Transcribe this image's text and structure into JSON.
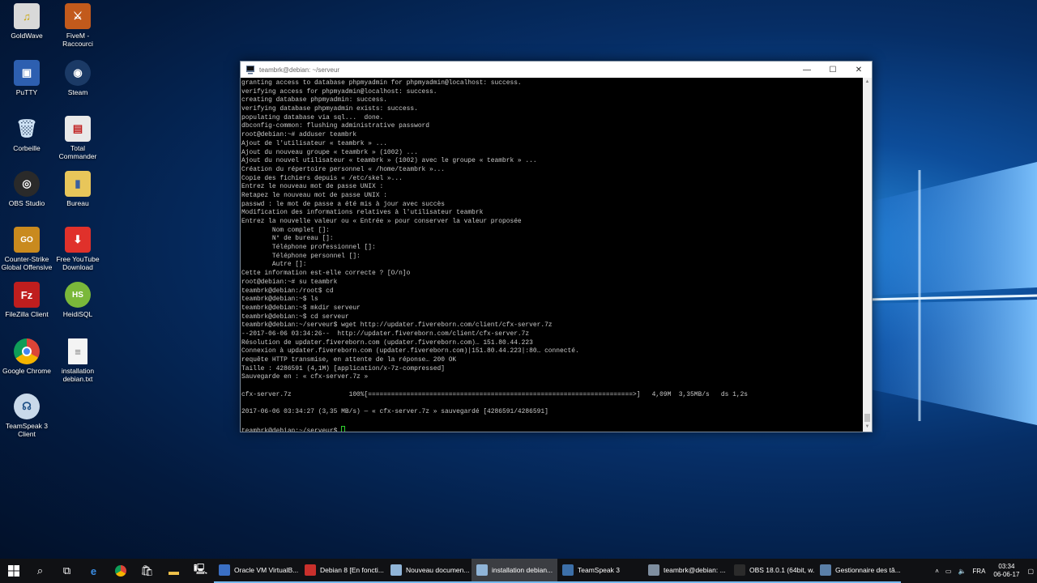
{
  "desktop_icons": [
    {
      "label": "GoldWave"
    },
    {
      "label": "FiveM - Raccourci"
    },
    {
      "label": "PuTTY"
    },
    {
      "label": "Steam"
    },
    {
      "label": "Corbeille"
    },
    {
      "label": "Total Commander"
    },
    {
      "label": "OBS Studio"
    },
    {
      "label": "Bureau"
    },
    {
      "label": "Counter-Strike Global Offensive"
    },
    {
      "label": "Free YouTube Download"
    },
    {
      "label": "FileZilla Client"
    },
    {
      "label": "HeidiSQL"
    },
    {
      "label": "Google Chrome"
    },
    {
      "label": "installation debian.txt"
    },
    {
      "label": "TeamSpeak 3 Client"
    }
  ],
  "window": {
    "title": "teambrk@debian: ~/serveur",
    "minimize": "—",
    "maximize": "☐",
    "close": "✕"
  },
  "terminal": {
    "lines": [
      "granting access to database phpmyadmin for phpmyadmin@localhost: success.",
      "verifying access for phpmyadmin@localhost: success.",
      "creating database phpmyadmin: success.",
      "verifying database phpmyadmin exists: success.",
      "populating database via sql...  done.",
      "dbconfig-common: flushing administrative password",
      "root@debian:~# adduser teambrk",
      "Ajout de l'utilisateur « teambrk » ...",
      "Ajout du nouveau groupe « teambrk » (1002) ...",
      "Ajout du nouvel utilisateur « teambrk » (1002) avec le groupe « teambrk » ...",
      "Création du répertoire personnel « /home/teambrk »...",
      "Copie des fichiers depuis « /etc/skel »...",
      "Entrez le nouveau mot de passe UNIX :",
      "Retapez le nouveau mot de passe UNIX :",
      "passwd : le mot de passe a été mis à jour avec succès",
      "Modification des informations relatives à l'utilisateur teambrk",
      "Entrez la nouvelle valeur ou « Entrée » pour conserver la valeur proposée",
      "        Nom complet []:",
      "        N° de bureau []:",
      "        Téléphone professionnel []:",
      "        Téléphone personnel []:",
      "        Autre []:",
      "Cette information est-elle correcte ? [O/n]o",
      "root@debian:~# su teambrk",
      "teambrk@debian:/root$ cd",
      "teambrk@debian:~$ ls",
      "teambrk@debian:~$ mkdir serveur",
      "teambrk@debian:~$ cd serveur",
      "teambrk@debian:~/serveur$ wget http://updater.fivereborn.com/client/cfx-server.7z",
      "--2017-06-06 03:34:26--  http://updater.fivereborn.com/client/cfx-server.7z",
      "Résolution de updater.fivereborn.com (updater.fivereborn.com)… 151.80.44.223",
      "Connexion à updater.fivereborn.com (updater.fivereborn.com)|151.80.44.223|:80… connecté.",
      "requête HTTP transmise, en attente de la réponse… 200 OK",
      "Taille : 4286591 (4,1M) [application/x-7z-compressed]",
      "Sauvegarde en : « cfx-server.7z »",
      "",
      "cfx-server.7z               100%[=====================================================================>]   4,09M  3,35MB/s   ds 1,2s",
      "",
      "2017-06-06 03:34:27 (3,35 MB/s) — « cfx-server.7z » sauvegardé [4286591/4286591]",
      ""
    ],
    "prompt": "teambrk@debian:~/serveur$ "
  },
  "taskbar": {
    "apps": [
      {
        "label": "Oracle VM VirtualB...",
        "color": "#3a6fc4",
        "active": false
      },
      {
        "label": "Debian 8 [En foncti...",
        "color": "#c9302c",
        "active": false
      },
      {
        "label": "Nouveau documen...",
        "color": "#8fb4d8",
        "active": false
      },
      {
        "label": "installation debian...",
        "color": "#8fb4d8",
        "active": true
      },
      {
        "label": "TeamSpeak 3",
        "color": "#3c6fa8",
        "active": false
      },
      {
        "label": "teambrk@debian: ...",
        "color": "#7e8ea0",
        "active": false
      },
      {
        "label": "OBS 18.0.1 (64bit, w...",
        "color": "#2b2b2b",
        "active": false
      },
      {
        "label": "Gestionnaire des tâ...",
        "color": "#5a7fa8",
        "active": false
      }
    ],
    "language": "FRA",
    "time": "03:34",
    "date": "06-06-17"
  }
}
